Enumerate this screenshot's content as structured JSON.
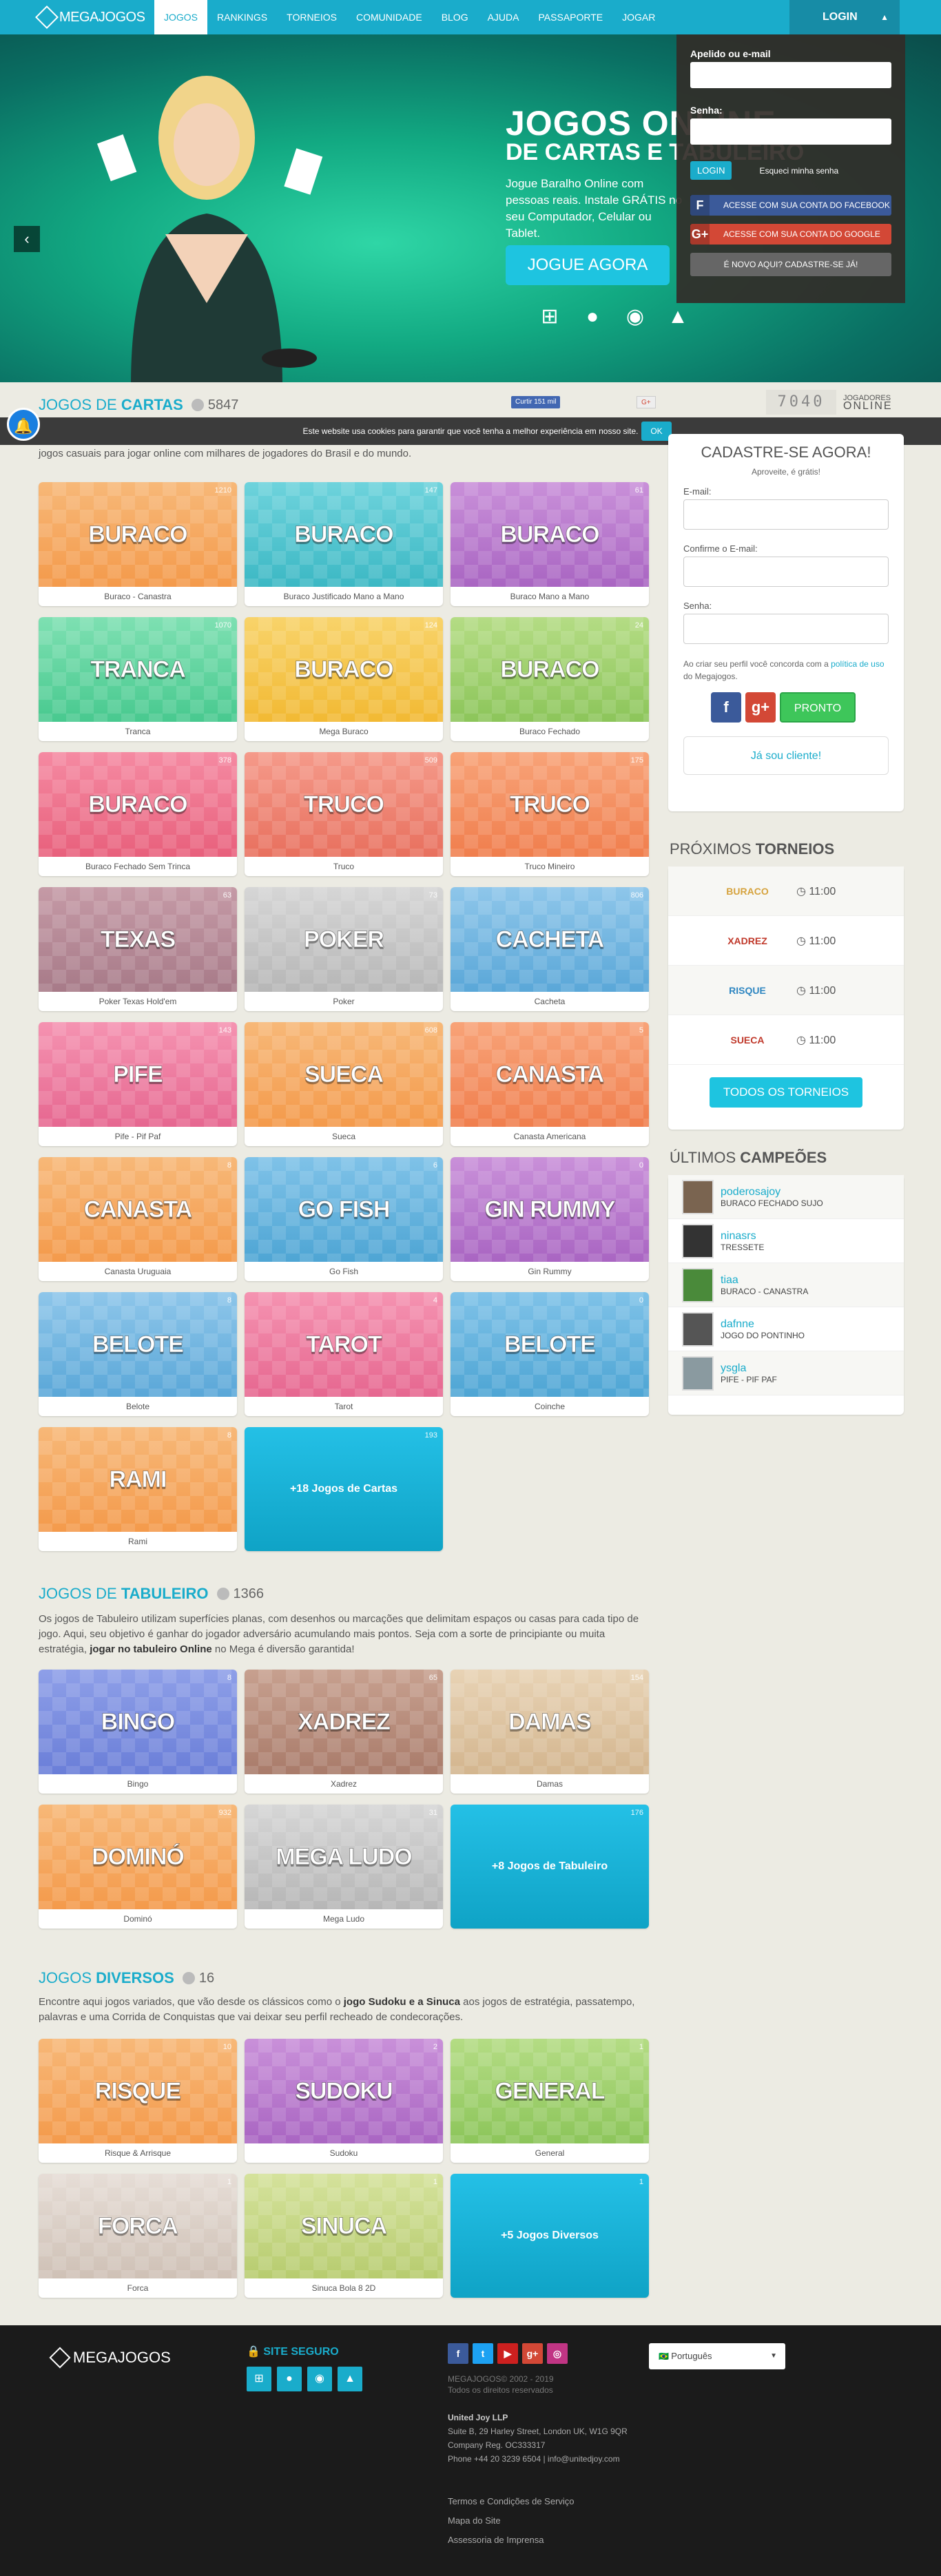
{
  "header": {
    "logo": "MEGAJOGOS",
    "nav": [
      "JOGOS",
      "RANKINGS",
      "TORNEIOS",
      "COMUNIDADE",
      "BLOG",
      "AJUDA",
      "PASSAPORTE",
      "JOGAR"
    ],
    "login": "LOGIN"
  },
  "login_panel": {
    "user_label": "Apelido ou e-mail",
    "pass_label": "Senha:",
    "login_btn": "LOGIN",
    "forgot": "Esqueci minha senha",
    "facebook": "ACESSE COM SUA CONTA DO FACEBOOK",
    "google": "ACESSE COM SUA CONTA DO GOOGLE",
    "new_account": "É NOVO AQUI? CADASTRE-SE JÁ!"
  },
  "hero": {
    "title": "JOGOS ONLINE",
    "subtitle": "DE CARTAS E TABULEIRO",
    "text": "Jogue Baralho Online com pessoas reais. Instale GRÁTIS no seu Computador, Celular ou Tablet.",
    "cta": "JOGUE AGORA",
    "os": [
      "windows",
      "apple",
      "android",
      "linux"
    ],
    "prev": "‹",
    "next": "›"
  },
  "cookie": {
    "text": "Este website usa cookies para garantir que você tenha a melhor experiência em nosso site.",
    "ok": "OK"
  },
  "online": {
    "count": "7040",
    "label1": "JOGADORES",
    "label2": "ONLINE"
  },
  "social_counts": {
    "facebook": "Curtir 151 mil",
    "gplus": "G+"
  },
  "cards_section": {
    "title_a": "JOGOS DE",
    "title_b": "CARTAS",
    "count": "5847",
    "desc": "jogos casuais para jogar online com milhares de jogadores do Brasil e do mundo.",
    "games": [
      {
        "logo": "BURACO",
        "name": "Buraco - Canastra",
        "players": "1210",
        "color": "c-orange"
      },
      {
        "logo": "BURACO",
        "name": "Buraco Justificado Mano a Mano",
        "players": "147",
        "color": "c-teal"
      },
      {
        "logo": "BURACO",
        "name": "Buraco Mano a Mano",
        "players": "61",
        "color": "c-purple"
      },
      {
        "logo": "TRANCA",
        "name": "Tranca",
        "players": "1070",
        "color": "c-green"
      },
      {
        "logo": "BURACO",
        "name": "Mega Buraco",
        "players": "124",
        "color": "c-yellow"
      },
      {
        "logo": "BURACO",
        "name": "Buraco Fechado",
        "players": "24",
        "color": "c-lime"
      },
      {
        "logo": "BURACO",
        "name": "Buraco Fechado Sem Trinca",
        "players": "378",
        "color": "c-rose"
      },
      {
        "logo": "TRUCO",
        "name": "Truco",
        "players": "509",
        "color": "c-red"
      },
      {
        "logo": "TRUCO",
        "name": "Truco Mineiro",
        "players": "175",
        "color": "c-coral"
      },
      {
        "logo": "TEXAS",
        "name": "Poker Texas Hold'em",
        "players": "63",
        "color": "c-mauve"
      },
      {
        "logo": "POKER",
        "name": "Poker",
        "players": "73",
        "color": "c-grey"
      },
      {
        "logo": "CACHETA",
        "name": "Cacheta",
        "players": "806",
        "color": "c-blue"
      },
      {
        "logo": "PIFE",
        "name": "Pife - Pif Paf",
        "players": "143",
        "color": "c-pink"
      },
      {
        "logo": "SUECA",
        "name": "Sueca",
        "players": "608",
        "color": "c-orange"
      },
      {
        "logo": "CANASTA",
        "name": "Canasta Americana",
        "players": "5",
        "color": "c-coral"
      },
      {
        "logo": "CANASTA",
        "name": "Canasta Uruguaia",
        "players": "8",
        "color": "c-orange"
      },
      {
        "logo": "GO FISH",
        "name": "Go Fish",
        "players": "6",
        "color": "c-sky"
      },
      {
        "logo": "GIN RUMMY",
        "name": "Gin Rummy",
        "players": "0",
        "color": "c-purple"
      },
      {
        "logo": "BELOTE",
        "name": "Belote",
        "players": "8",
        "color": "c-blue"
      },
      {
        "logo": "TAROT",
        "name": "Tarot",
        "players": "4",
        "color": "c-pink"
      },
      {
        "logo": "BELOTE",
        "name": "Coinche",
        "players": "0",
        "color": "c-sky"
      },
      {
        "logo": "RAMI",
        "name": "Rami",
        "players": "8",
        "color": "c-orange"
      }
    ],
    "more": {
      "label": "+18 Jogos de Cartas",
      "players": "193"
    }
  },
  "board_section": {
    "title_a": "JOGOS DE",
    "title_b": "TABULEIRO",
    "count": "1366",
    "desc": "Os jogos de Tabuleiro utilizam superfícies planas, com desenhos ou marcações que delimitam espaços ou casas para cada tipo de jogo. Aqui, seu objetivo é ganhar do jogador adversário acumulando mais pontos. Seja com a sorte de principiante ou muita estratégia,",
    "desc_bold": "jogar no tabuleiro Online",
    "desc_end": "no Mega é diversão garantida!",
    "games": [
      {
        "logo": "BINGO",
        "name": "Bingo",
        "players": "8",
        "color": "c-indigo"
      },
      {
        "logo": "XADREZ",
        "name": "Xadrez",
        "players": "65",
        "color": "c-brown"
      },
      {
        "logo": "DAMAS",
        "name": "Damas",
        "players": "154",
        "color": "c-sand"
      },
      {
        "logo": "DOMINÓ",
        "name": "Dominó",
        "players": "932",
        "color": "c-orange"
      },
      {
        "logo": "MEGA LUDO",
        "name": "Mega Ludo",
        "players": "31",
        "color": "c-grey"
      }
    ],
    "more": {
      "label": "+8 Jogos de Tabuleiro",
      "players": "176"
    }
  },
  "misc_section": {
    "title_a": "JOGOS",
    "title_b": "DIVERSOS",
    "count": "16",
    "desc": "Encontre aqui jogos variados, que vão desde os clássicos como o",
    "desc_bold": "jogo Sudoku e a Sinuca",
    "desc_end": "aos jogos de estratégia, passatempo, palavras e uma Corrida de Conquistas que vai deixar seu perfil recheado de condecorações.",
    "games": [
      {
        "logo": "RISQUE",
        "name": "Risque & Arrisque",
        "players": "10",
        "color": "c-orange"
      },
      {
        "logo": "SUDOKU",
        "name": "Sudoku",
        "players": "2",
        "color": "c-purple"
      },
      {
        "logo": "GENERAL",
        "name": "General",
        "players": "1",
        "color": "c-lime"
      },
      {
        "logo": "FORCA",
        "name": "Forca",
        "players": "1",
        "color": "c-beige"
      },
      {
        "logo": "SINUCA",
        "name": "Sinuca Bola 8 2D",
        "players": "1",
        "color": "c-olive"
      }
    ],
    "more": {
      "label": "+5 Jogos Diversos",
      "players": "1"
    }
  },
  "register": {
    "title": "CADASTRE-SE AGORA!",
    "sub": "Aproveite, é grátis!",
    "email": "E-mail:",
    "confirm": "Confirme o E-mail:",
    "pass": "Senha:",
    "note": "Ao criar seu perfil você concorda com a",
    "policy": "política de uso",
    "note_end": "do Megajogos.",
    "pronto": "PRONTO",
    "already": "Já sou cliente!"
  },
  "tournaments": {
    "title_a": "PRÓXIMOS",
    "title_b": "TORNEIOS",
    "items": [
      {
        "game": "BURACO",
        "time": "11:00"
      },
      {
        "game": "XADREZ",
        "time": "11:00"
      },
      {
        "game": "RISQUE",
        "time": "11:00"
      },
      {
        "game": "SUECA",
        "time": "11:00"
      }
    ],
    "all": "TODOS OS TORNEIOS"
  },
  "champions": {
    "title_a": "ÚLTIMOS",
    "title_b": "CAMPEÕES",
    "items": [
      {
        "name": "poderosajoy",
        "game": "BURACO FECHADO SUJO"
      },
      {
        "name": "ninasrs",
        "game": "TRESSETE"
      },
      {
        "name": "tiaa",
        "game": "BURACO - CANASTRA"
      },
      {
        "name": "dafnne",
        "game": "JOGO DO PONTINHO"
      },
      {
        "name": "ysgla",
        "game": "PIFE - PIF PAF"
      }
    ]
  },
  "footer": {
    "logo": "MEGAJOGOS",
    "secure": "SITE SEGURO",
    "copy1": "MEGAJOGOS© 2002 - 2019",
    "copy2": "Todos os direitos reservados",
    "company": "United Joy LLP",
    "addr1": "Suite B, 29 Harley Street, London UK, W1G 9QR",
    "addr2": "Company Reg. OC333317",
    "addr3": "Phone +44 20 3239 6504 | info@unitedjoy.com",
    "links": [
      "Termos e Condições de Serviço",
      "Mapa do Site",
      "Assessoria de Imprensa"
    ],
    "language": "Português"
  }
}
